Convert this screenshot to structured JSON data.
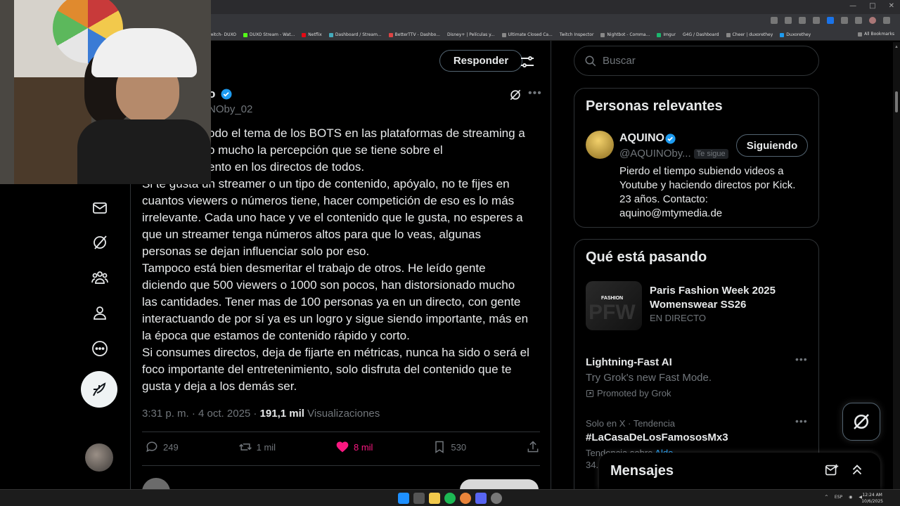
{
  "browser": {
    "bookmarks": [
      "twitch- DUXO",
      "DUXO Stream - Wat...",
      "Netflix",
      "Dashboard / Stream...",
      "BetterTTV - Dashbo...",
      "Disney+ | Películas y...",
      "Ultimate Closed Ca...",
      "Twitch Inspector",
      "Nightbot - Comma...",
      "Imgur",
      "G4G / Dashboard",
      "Cheer | duxorethey",
      "Duxorethey"
    ],
    "all_bookmarks": "All Bookmarks"
  },
  "header": {
    "reply_label": "Responder"
  },
  "tweet": {
    "author_tail": "o",
    "handle_tail": "NOby_02",
    "lines": [
      "odo el tema de los BOTS en las plataformas de streaming a",
      "o mucho la percepción que se tiene sobre el",
      "ento en los directos de todos.",
      "Si te gusta un streamer o un tipo de contenido, apóyalo, no te fijes en",
      "cuantos viewers o números tiene, hacer competición de eso es lo más",
      "irrelevante. Cada uno hace y ve el contenido que le gusta, no esperes a",
      "que un streamer tenga números altos para que lo veas, algunas",
      "personas se dejan influenciar solo por eso.",
      "Tampoco está bien desmeritar el trabajo de otros. He leído gente",
      "diciendo que 500 viewers o 1000 son pocos, han distorsionado mucho",
      "las cantidades. Tener mas de 100 personas ya en un directo, con gente",
      "interactuando de por sí ya es un logro y sigue siendo importante, más en",
      "la época que estamos de contenido rápido y corto.",
      "Si consumes directos, deja de fijarte en métricas, nunca ha sido o será el",
      "foco importante del entretenimiento, solo disfruta del contenido que te",
      "gusta y deja a los demás ser."
    ],
    "time": "3:31 p. m. · 4 oct. 2025 · ",
    "views_count": "191,1 mil",
    "views_label": " Visualizaciones",
    "replies": "249",
    "reposts": "1 mil",
    "likes": "8 mil",
    "bookmarks": "530"
  },
  "search": {
    "placeholder": "Buscar"
  },
  "relevant": {
    "title": "Personas relevantes",
    "name": "AQUINO",
    "handle": "@AQUINOby...",
    "follows_you": "Te sigue",
    "follow_label": "Siguiendo",
    "bio": "Pierdo el tiempo subiendo videos a Youtube y haciendo directos por Kick. 23 años. Contacto: aquino@mtymedia.de"
  },
  "trending": {
    "title": "Qué está pasando",
    "event_image_text": "FASHION",
    "event_image_bg": "PFW",
    "event_title": "Paris Fashion Week 2025 Womenswear SS26",
    "event_sub": "EN DIRECTO",
    "ad_title": "Lightning-Fast AI",
    "ad_desc": "Try Grok's new Fast Mode.",
    "ad_promo": "Promoted by Grok",
    "trend_cat": "Solo en X · Tendencia",
    "trend_title": "#LaCasaDeLosFamososMx3",
    "trend_sub_prefix": "Tendencia sobre ",
    "trend_sub_link": "Aldo",
    "trend_count": "34..."
  },
  "messages": {
    "title": "Mensajes"
  },
  "taskbar": {
    "tray": [
      "ESP"
    ],
    "time": "12:24 AM",
    "date": "10/6/2025"
  },
  "colors": {
    "accent": "#1d9bf0",
    "like": "#f91880",
    "border": "#2f3336",
    "muted": "#71767b"
  }
}
